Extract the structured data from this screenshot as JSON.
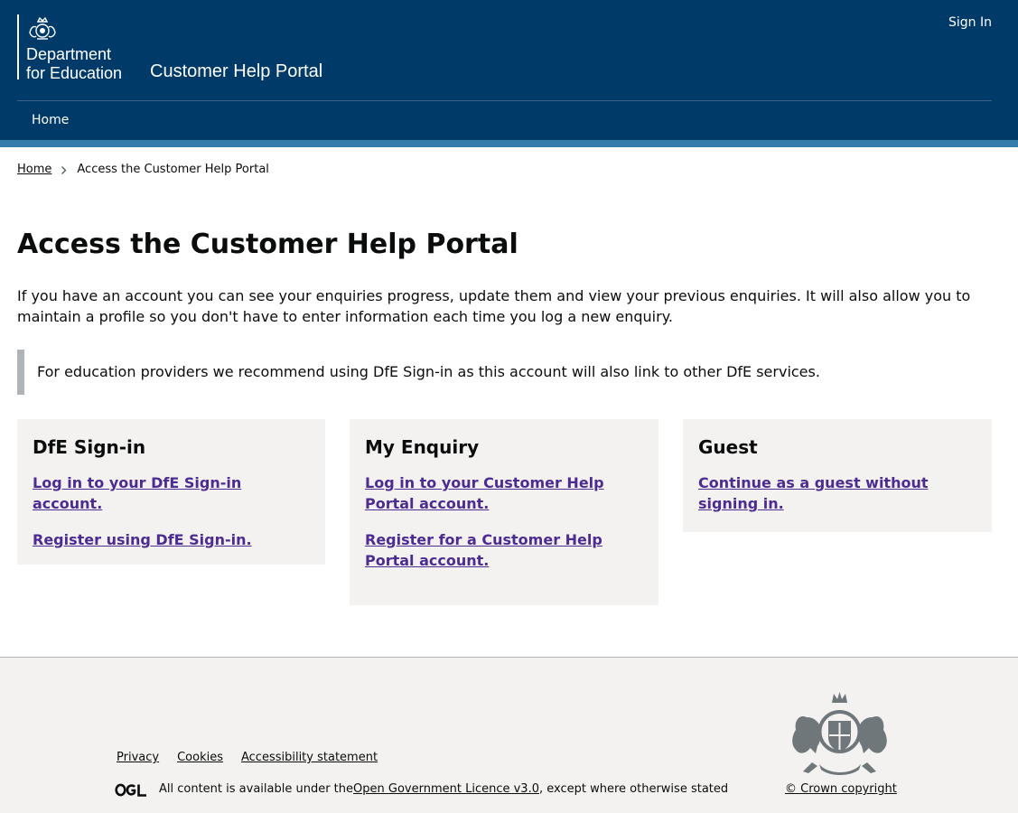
{
  "header": {
    "department_line1": "Department",
    "department_line2": "for Education",
    "service_name": "Customer Help Portal",
    "sign_in_label": "Sign In",
    "nav": [
      {
        "label": "Home"
      }
    ]
  },
  "breadcrumb": {
    "home_label": "Home",
    "current_label": "Access the Customer Help Portal"
  },
  "main": {
    "title": "Access the Customer Help Portal",
    "intro": "If you have an account you can see your enquiries progress, update them and view your previous enquiries. It will also allow you to maintain a profile so you don't have to enter information each time you log a new enquiry.",
    "inset": "For education providers we recommend using DfE Sign-in as this account will also link to other DfE services.",
    "cards": [
      {
        "title": "DfE Sign-in",
        "links": [
          "Log in to your DfE Sign-in account.",
          "Register using DfE Sign-in."
        ]
      },
      {
        "title": "My Enquiry",
        "links": [
          "Log in to your Customer Help Portal account.",
          "Register for a Customer Help Portal account."
        ]
      },
      {
        "title": "Guest",
        "links": [
          "Continue as a guest without signing in."
        ]
      }
    ]
  },
  "footer": {
    "links": [
      "Privacy",
      "Cookies",
      "Accessibility statement"
    ],
    "licence_prefix": "All content is available under the ",
    "licence_link": "Open Government Licence v3.0",
    "licence_suffix": ", except where otherwise stated",
    "crown_copyright": "© Crown copyright"
  },
  "colors": {
    "header_bg": "#003a69",
    "accent_bar": "#347ca9",
    "link_visited": "#4c2c92",
    "card_bg": "#f3f2f1"
  },
  "icons": [
    "royal-crest-icon",
    "chevron-right-icon",
    "ogl-logo-icon",
    "royal-coat-of-arms-icon"
  ]
}
